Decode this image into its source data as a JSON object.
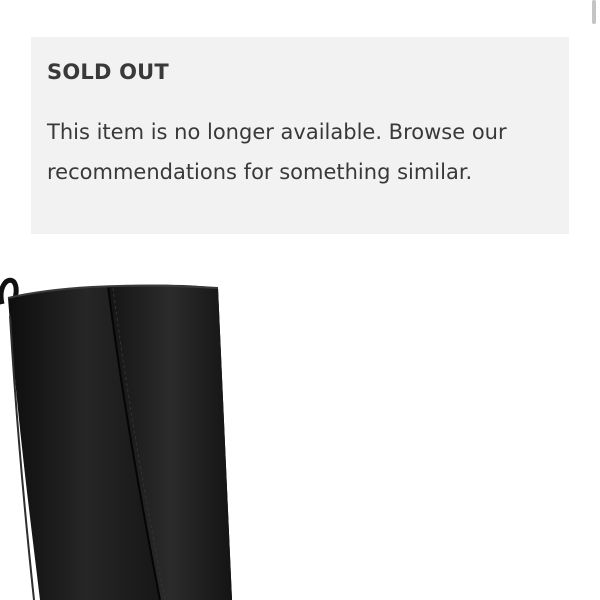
{
  "notice": {
    "title": "SOLD OUT",
    "body": "This item is no longer available. Browse our recommendations for something similar."
  },
  "product_image": {
    "alt": "Black leather knee-high boot"
  },
  "colors": {
    "notice_background": "#f2f2f2",
    "text": "#393939",
    "boot": "#1c1c1c"
  }
}
